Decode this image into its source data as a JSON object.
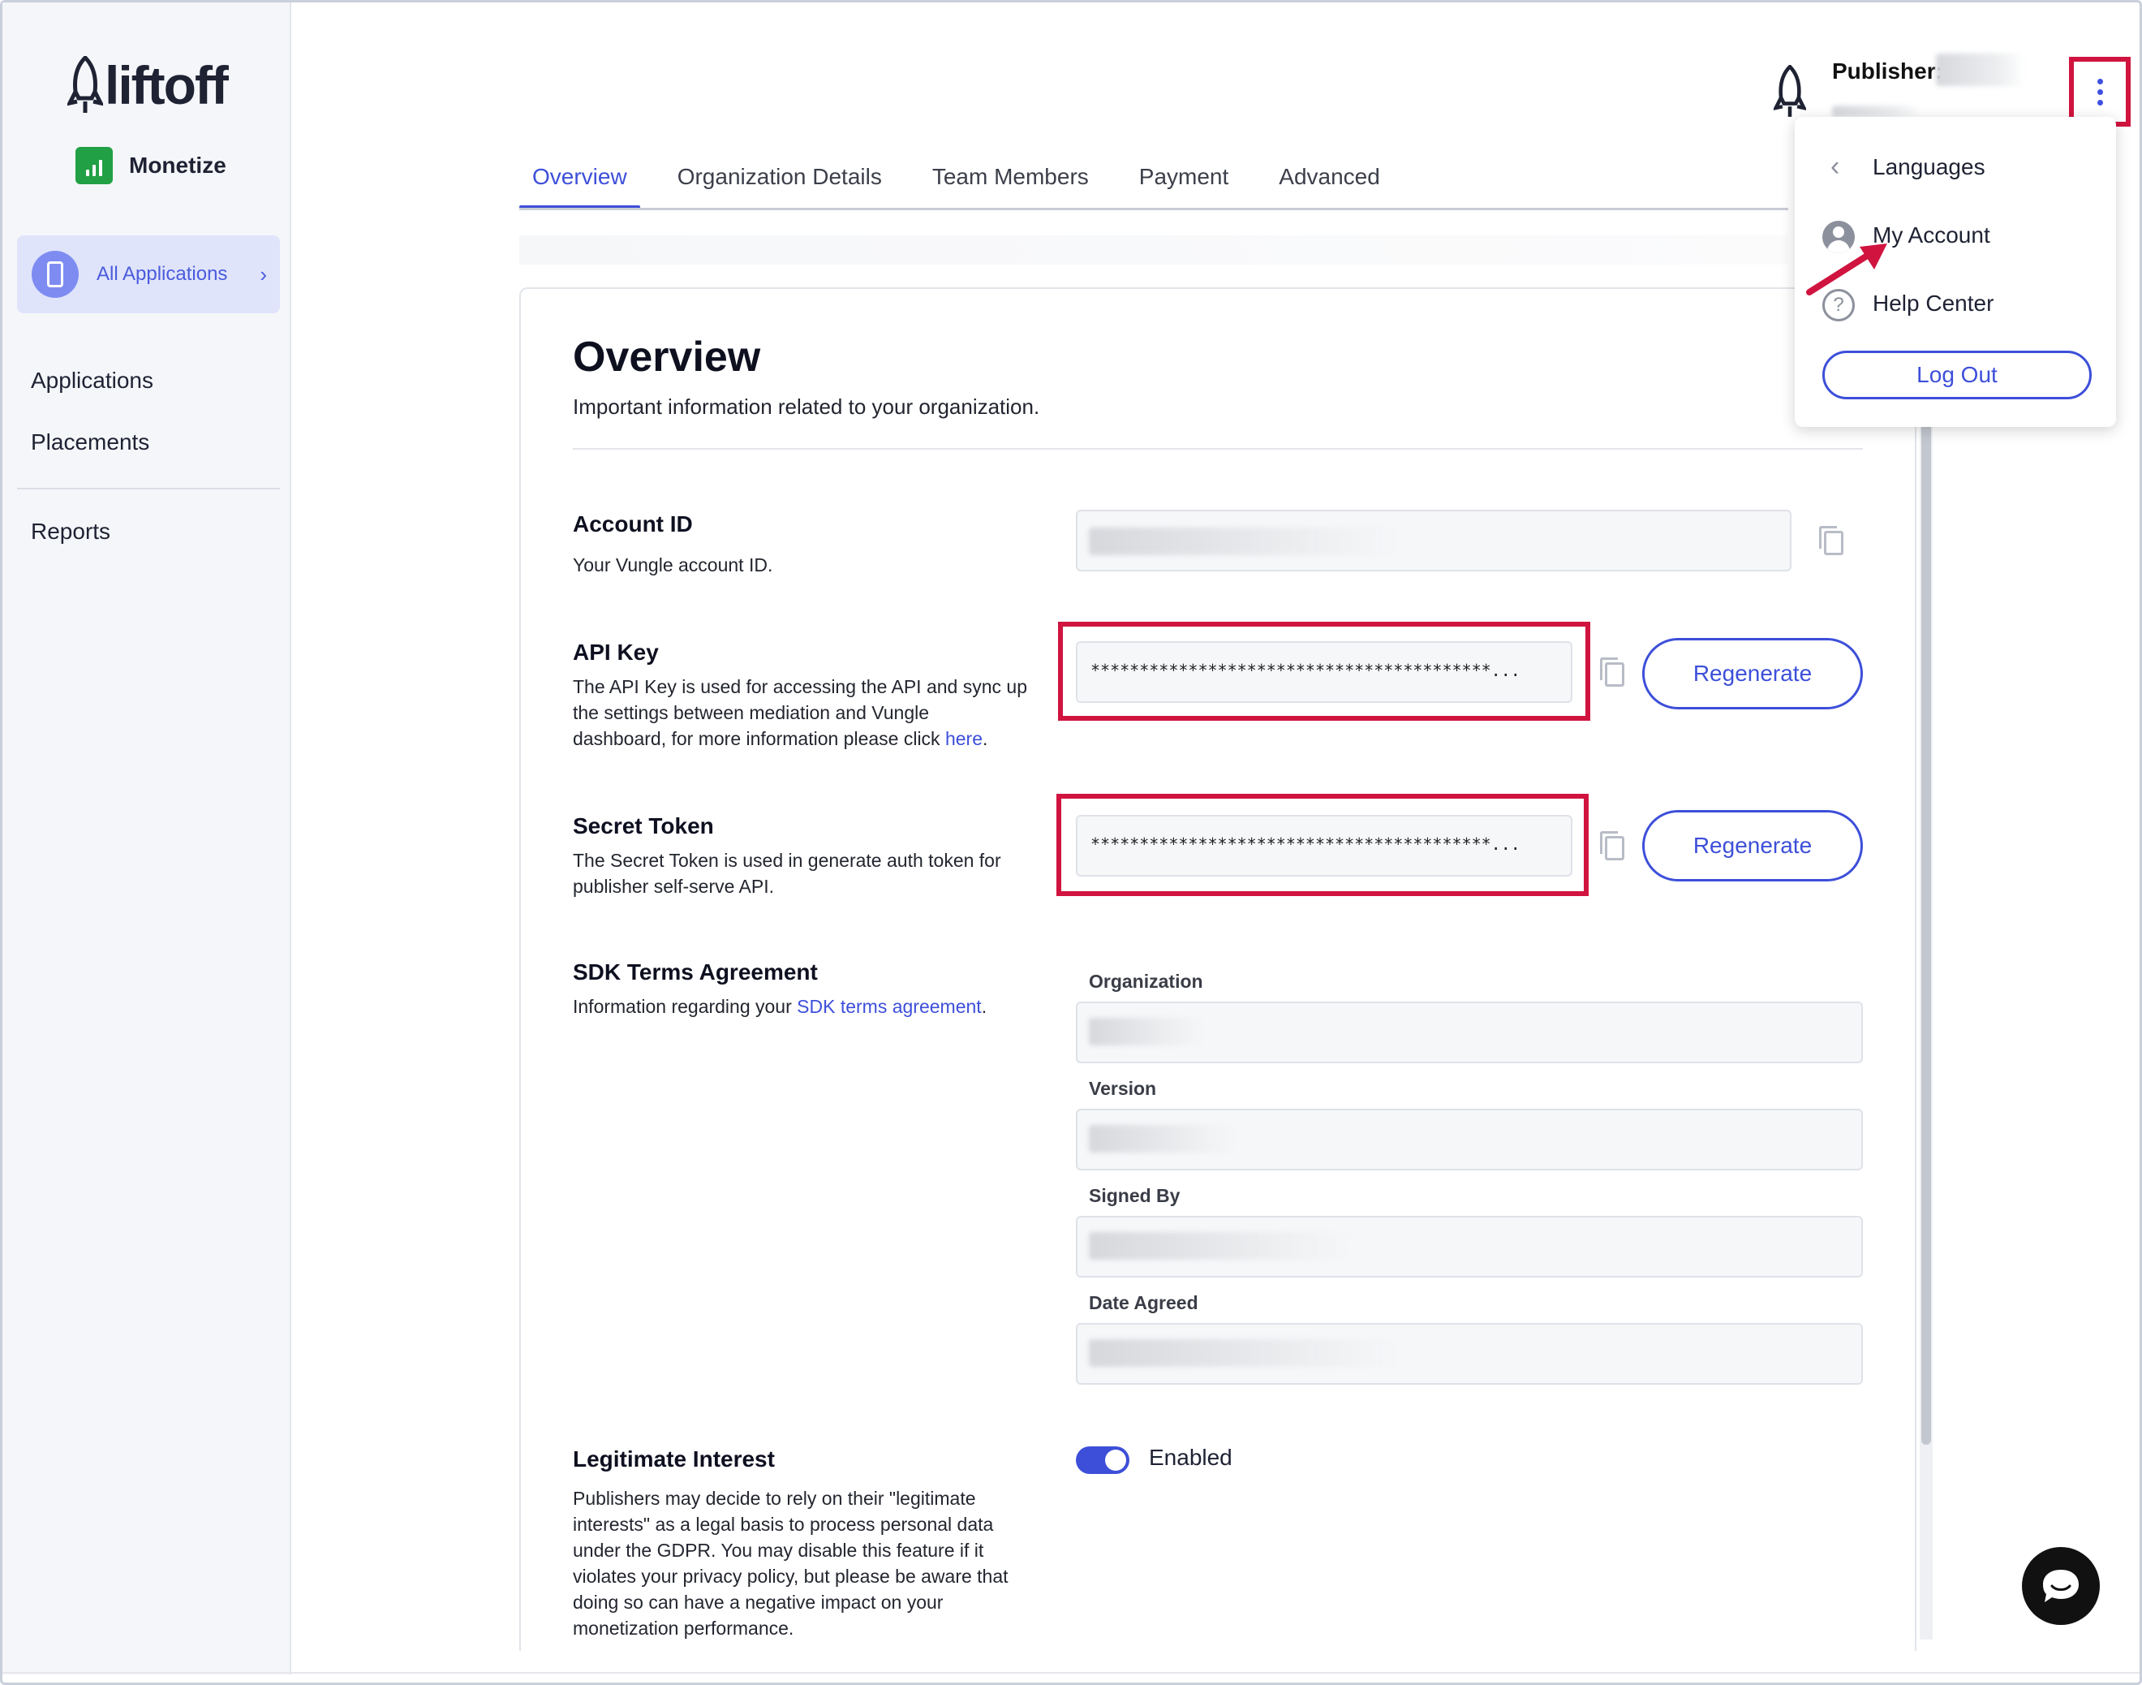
{
  "sidebar": {
    "logo_text": "liftoff",
    "product": "Monetize",
    "all_apps_label": "All Applications",
    "all_apps_chevron": "›",
    "items": [
      {
        "label": "Applications"
      },
      {
        "label": "Placements"
      },
      {
        "label": "Reports"
      }
    ]
  },
  "header": {
    "publisher_label": "Publisher:",
    "menu_icon": "kebab-menu-icon"
  },
  "tabs": [
    {
      "label": "Overview",
      "active": true
    },
    {
      "label": "Organization Details",
      "active": false
    },
    {
      "label": "Team Members",
      "active": false
    },
    {
      "label": "Payment",
      "active": false
    },
    {
      "label": "Advanced",
      "active": false
    }
  ],
  "overview": {
    "title": "Overview",
    "subtitle": "Important information related to your organization."
  },
  "account_id": {
    "title": "Account ID",
    "description": "Your Vungle account ID."
  },
  "api_key": {
    "title": "API Key",
    "description_prefix": "The API Key is used for accessing the API and sync up the settings between mediation and Vungle dashboard, for more information please click ",
    "link_text": "here",
    "description_suffix": ".",
    "masked_value": "*****************************************...",
    "button_label": "Regenerate"
  },
  "secret_token": {
    "title": "Secret Token",
    "description": "The Secret Token is used in generate auth token for publisher self-serve API.",
    "masked_value": "*****************************************...",
    "button_label": "Regenerate"
  },
  "sdk_terms": {
    "title": "SDK Terms Agreement",
    "description_prefix": "Information regarding your ",
    "link_text": "SDK terms agreement",
    "description_suffix": ".",
    "fields": [
      {
        "label": "Organization"
      },
      {
        "label": "Version"
      },
      {
        "label": "Signed By"
      },
      {
        "label": "Date Agreed"
      }
    ]
  },
  "legitimate_interest": {
    "title": "Legitimate Interest",
    "description": "Publishers may decide to rely on their \"legitimate interests\" as a legal basis to process personal data under the GDPR. You may disable this feature if it violates your privacy policy, but please be aware that doing so can have a negative impact on your monetization performance.",
    "toggle_on": true,
    "toggle_label": "Enabled"
  },
  "dropdown": {
    "back_glyph": "‹",
    "languages": "Languages",
    "my_account": "My Account",
    "help_center": "Help Center",
    "help_glyph": "?",
    "logout": "Log Out"
  },
  "colors": {
    "accent": "#3d4fd9",
    "highlight": "#d0143f",
    "brand_green": "#22a045"
  }
}
